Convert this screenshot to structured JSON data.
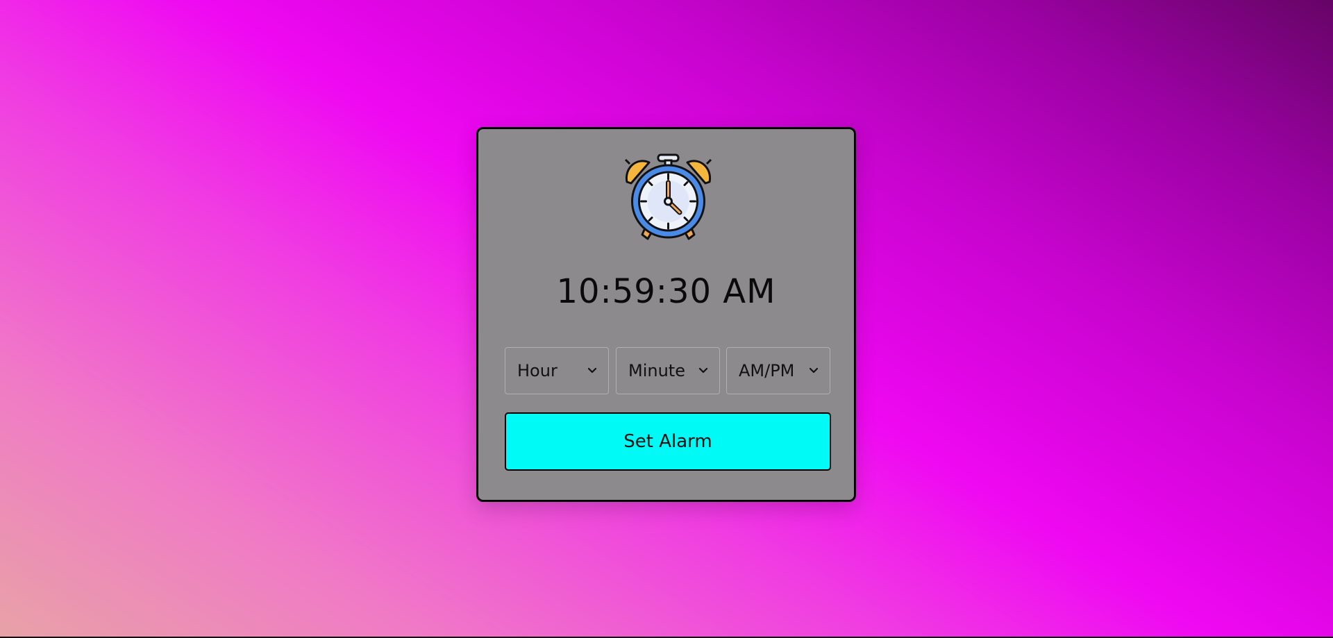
{
  "clock": {
    "time": "10:59:30 AM",
    "icon": "alarm-clock-icon"
  },
  "selects": {
    "hour_label": "Hour",
    "minute_label": "Minute",
    "ampm_label": "AM/PM"
  },
  "actions": {
    "set_alarm_label": "Set Alarm"
  },
  "colors": {
    "card_background": "#8c8a8c",
    "button_accent": "#00fbf7",
    "clock_ring": "#4a8be8",
    "bells": "#f5b63e"
  }
}
